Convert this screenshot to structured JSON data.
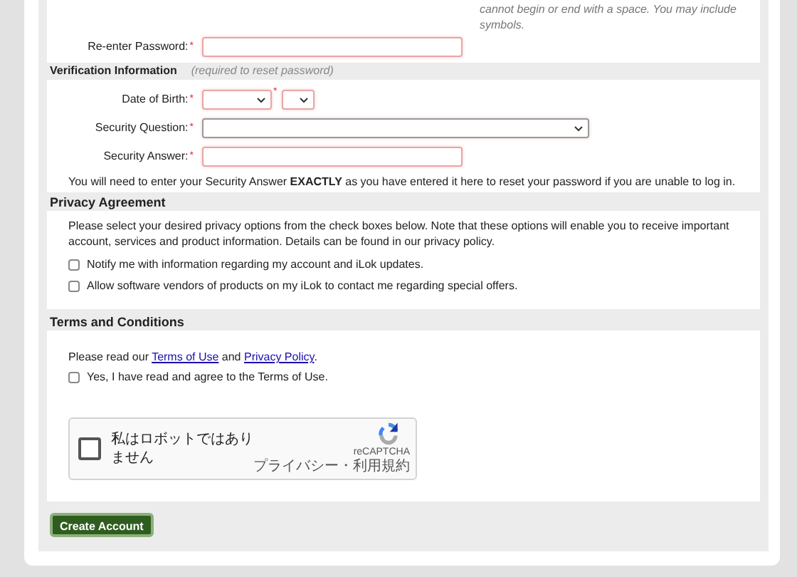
{
  "password_hint": [
    "cannot begin or end with a space. You may include",
    "symbols."
  ],
  "reenter_password": {
    "label": "Re-enter Password:",
    "required_mark": "*"
  },
  "verification": {
    "title": "Verification Information",
    "note": "(required to reset password)",
    "fields": [
      {
        "kind": "date",
        "label": "Date of Birth:",
        "required_mark": "*",
        "second_mark": "*"
      },
      {
        "kind": "select",
        "label": "Security Question:",
        "required_mark": "*"
      },
      {
        "kind": "text",
        "label": "Security Answer:",
        "required_mark": "*"
      }
    ],
    "notice": "You will need to enter your Security Answer **EXACTLY** as you have entered it here to reset your password if you are unable to log in."
  },
  "privacy": {
    "title": "Privacy Agreement",
    "text": "Please select your desired privacy options from the check boxes below. Note that these options will enable you to receive important account, services and product information. Details can be found in our privacy policy.",
    "options": [
      {
        "label": "Notify me with information regarding my account and iLok updates.",
        "checked": false
      },
      {
        "label": "Allow software vendors of products on my iLok to contact me regarding special offers.",
        "checked": false
      }
    ]
  },
  "terms": {
    "title": "Terms and Conditions",
    "read_prefix": "Please read our",
    "link_1": "Terms of Use",
    "read_and": "and",
    "link_2": "Privacy Policy",
    "read_suffix": ".",
    "agree": {
      "label": "Yes, I have read and agree to the Terms of Use.",
      "checked": false
    }
  },
  "captcha": {
    "label": "私はロボットではありません",
    "checked": false,
    "brand": "reCAPTCHA",
    "links": "プライバシー・利用規約"
  },
  "submit": "Create Account"
}
